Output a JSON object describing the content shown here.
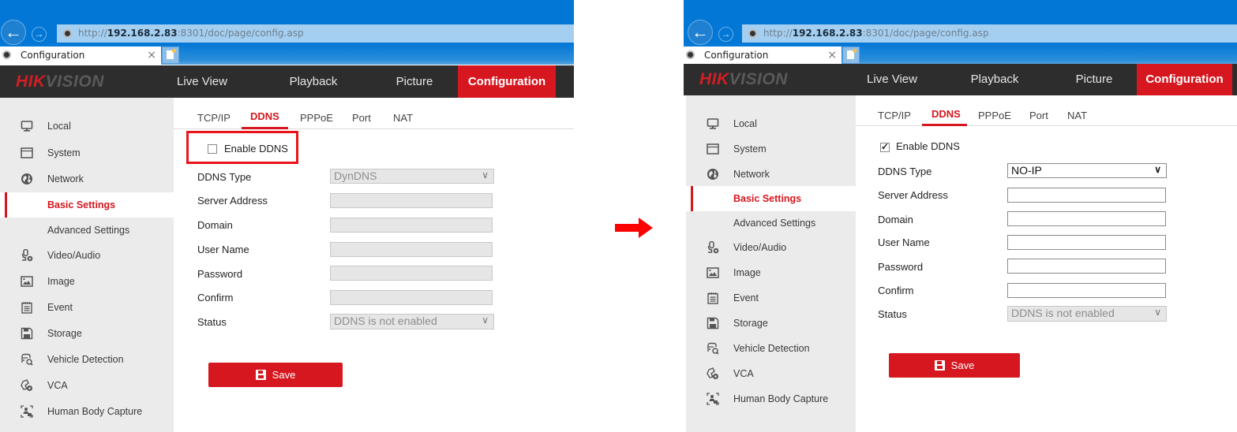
{
  "colors": {
    "brand_red": "#d6171f",
    "header_dark": "#2d2d2d",
    "sidebar_bg": "#ebebeb",
    "browser_blue": "#0377d6",
    "address_bar": "#a5cff1",
    "highlight": "#e8141b"
  },
  "annotation": {
    "arrow": "right-arrow",
    "highlight_target": "Enable DDNS"
  },
  "panels": [
    {
      "id": "before",
      "browser": {
        "url_prefix": "http://",
        "url_host": "192.168.2.83",
        "url_rest": ":8301/doc/page/config.asp",
        "tab_title": "Configuration",
        "tab_close": "×"
      },
      "app": {
        "logo_hik": "HIK",
        "logo_vision": "VISION",
        "nav": [
          "Live View",
          "Playback",
          "Picture",
          "Configuration"
        ],
        "nav_active": "Configuration"
      },
      "sidebar": {
        "items": [
          {
            "label": "Local",
            "icon": "monitor-icon"
          },
          {
            "label": "System",
            "icon": "window-icon"
          },
          {
            "label": "Network",
            "icon": "globe-icon"
          },
          {
            "label": "Basic Settings",
            "icon": "",
            "active": true
          },
          {
            "label": "Advanced Settings",
            "icon": ""
          },
          {
            "label": "Video/Audio",
            "icon": "microphone-camera-icon"
          },
          {
            "label": "Image",
            "icon": "image-icon"
          },
          {
            "label": "Event",
            "icon": "calendar-list-icon"
          },
          {
            "label": "Storage",
            "icon": "floppy-disk-icon"
          },
          {
            "label": "Vehicle Detection",
            "icon": "vehicle-search-icon"
          },
          {
            "label": "VCA",
            "icon": "vca-icon"
          },
          {
            "label": "Human Body Capture",
            "icon": "person-capture-icon"
          }
        ]
      },
      "tabs": [
        "TCP/IP",
        "DDNS",
        "PPPoE",
        "Port",
        "NAT"
      ],
      "active_tab": "DDNS",
      "form": {
        "enable_label": "Enable DDNS",
        "enable_checked": false,
        "ddns_type_label": "DDNS Type",
        "ddns_type_value": "DynDNS",
        "server_address_label": "Server Address",
        "server_address_value": "",
        "domain_label": "Domain",
        "domain_value": "",
        "user_name_label": "User Name",
        "user_name_value": "",
        "password_label": "Password",
        "password_value": "",
        "confirm_label": "Confirm",
        "confirm_value": "",
        "status_label": "Status",
        "status_value": "DDNS is not enabled",
        "fields_enabled": false
      },
      "save_label": "Save"
    },
    {
      "id": "after",
      "browser": {
        "url_prefix": "http://",
        "url_host": "192.168.2.83",
        "url_rest": ":8301/doc/page/config.asp",
        "tab_title": "Configuration",
        "tab_close": "×"
      },
      "app": {
        "logo_hik": "HIK",
        "logo_vision": "VISION",
        "nav": [
          "Live View",
          "Playback",
          "Picture",
          "Configuration"
        ],
        "nav_active": "Configuration"
      },
      "sidebar": {
        "items": [
          {
            "label": "Local",
            "icon": "monitor-icon"
          },
          {
            "label": "System",
            "icon": "window-icon"
          },
          {
            "label": "Network",
            "icon": "globe-icon"
          },
          {
            "label": "Basic Settings",
            "icon": "",
            "active": true
          },
          {
            "label": "Advanced Settings",
            "icon": ""
          },
          {
            "label": "Video/Audio",
            "icon": "microphone-camera-icon"
          },
          {
            "label": "Image",
            "icon": "image-icon"
          },
          {
            "label": "Event",
            "icon": "calendar-list-icon"
          },
          {
            "label": "Storage",
            "icon": "floppy-disk-icon"
          },
          {
            "label": "Vehicle Detection",
            "icon": "vehicle-search-icon"
          },
          {
            "label": "VCA",
            "icon": "vca-icon"
          },
          {
            "label": "Human Body Capture",
            "icon": "person-capture-icon"
          }
        ]
      },
      "tabs": [
        "TCP/IP",
        "DDNS",
        "PPPoE",
        "Port",
        "NAT"
      ],
      "active_tab": "DDNS",
      "form": {
        "enable_label": "Enable DDNS",
        "enable_checked": true,
        "ddns_type_label": "DDNS Type",
        "ddns_type_value": "NO-IP",
        "server_address_label": "Server Address",
        "server_address_value": "",
        "domain_label": "Domain",
        "domain_value": "",
        "user_name_label": "User Name",
        "user_name_value": "",
        "password_label": "Password",
        "password_value": "",
        "confirm_label": "Confirm",
        "confirm_value": "",
        "status_label": "Status",
        "status_value": "DDNS is not enabled",
        "fields_enabled": true
      },
      "save_label": "Save"
    }
  ]
}
